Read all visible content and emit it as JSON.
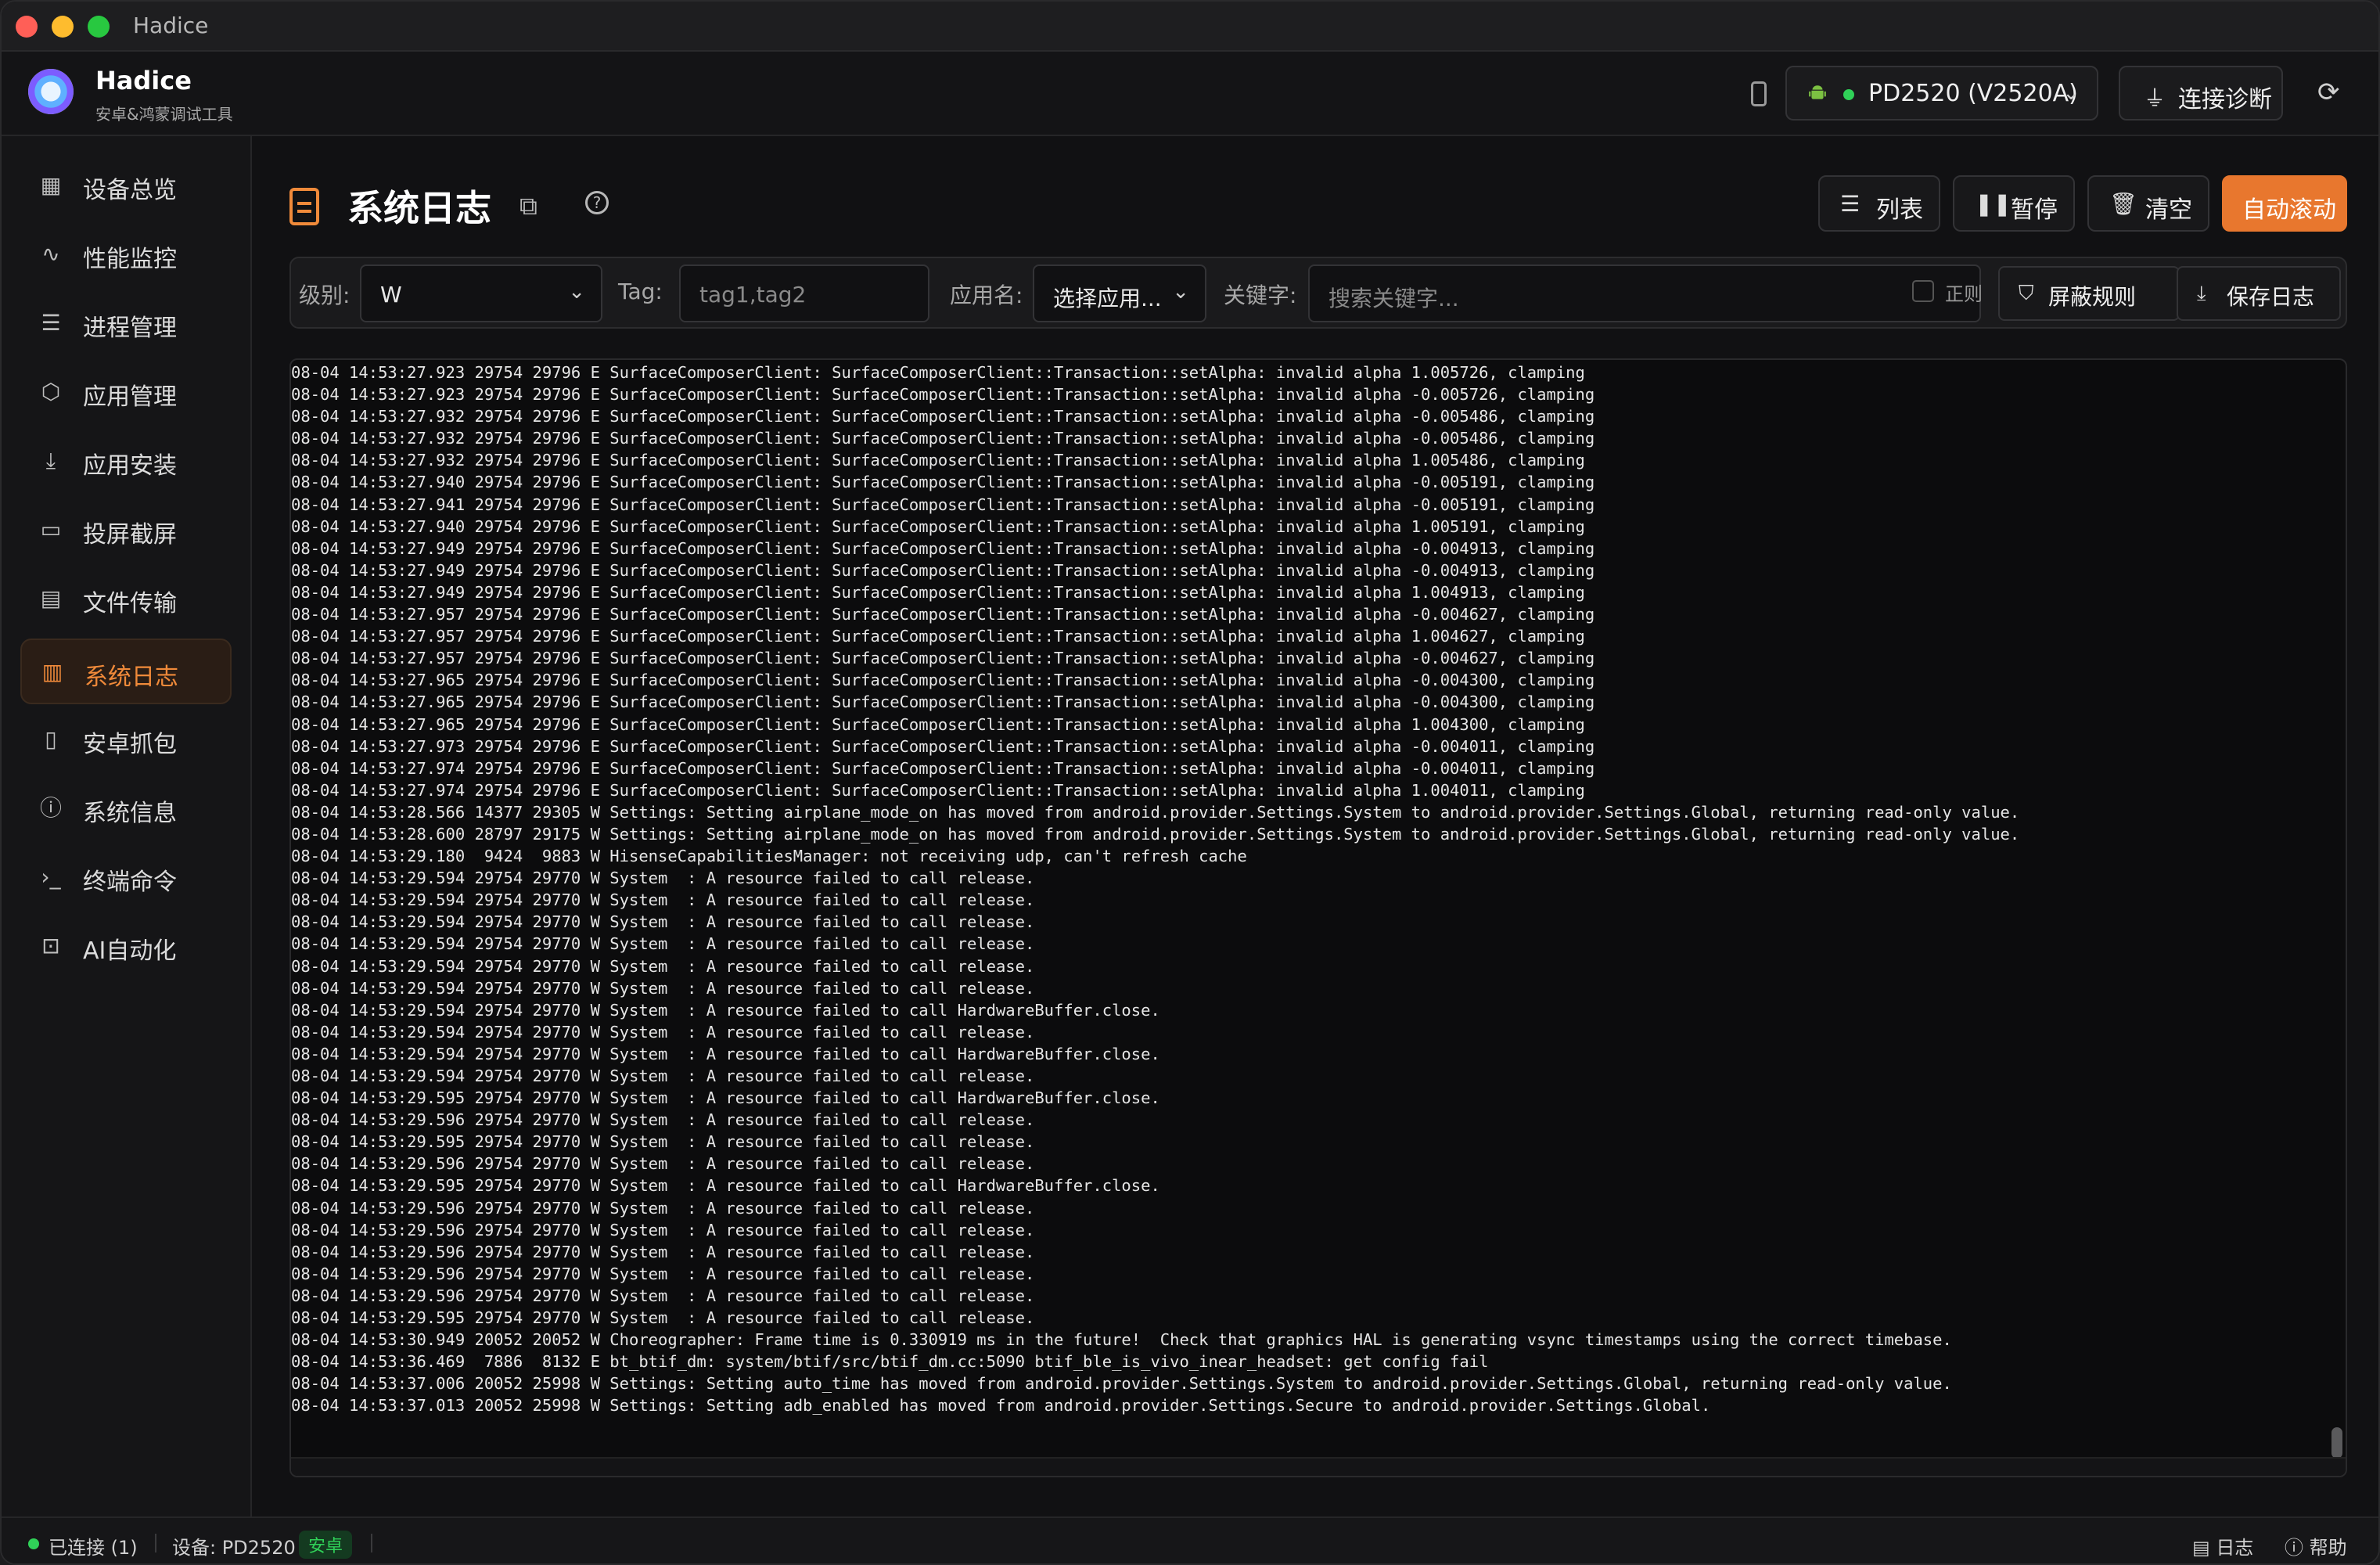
{
  "window": {
    "title": "Hadice"
  },
  "header": {
    "app_name": "Hadice",
    "app_subtitle": "安卓&鸿蒙调试工具",
    "device_label": "PD2520 (V2520A)",
    "diag_label": "连接诊断"
  },
  "sidebar": {
    "items": [
      {
        "label": "设备总览",
        "icon": "grid-icon"
      },
      {
        "label": "性能监控",
        "icon": "activity-icon"
      },
      {
        "label": "进程管理",
        "icon": "list-tree-icon"
      },
      {
        "label": "应用管理",
        "icon": "package-icon"
      },
      {
        "label": "应用安装",
        "icon": "download-icon"
      },
      {
        "label": "投屏截屏",
        "icon": "cast-icon"
      },
      {
        "label": "文件传输",
        "icon": "folder-sync-icon"
      },
      {
        "label": "系统日志",
        "icon": "file-text-icon",
        "active": true
      },
      {
        "label": "安卓抓包",
        "icon": "smartphone-icon"
      },
      {
        "label": "系统信息",
        "icon": "info-icon"
      },
      {
        "label": "终端命令",
        "icon": "terminal-icon"
      },
      {
        "label": "AI自动化",
        "icon": "bot-icon"
      }
    ]
  },
  "page": {
    "title": "系统日志",
    "toolbar": {
      "list": "列表",
      "pause": "暂停",
      "clear": "清空",
      "auto_scroll": "自动滚动"
    }
  },
  "filters": {
    "level_label": "级别:",
    "level_value": "W",
    "tag_label": "Tag:",
    "tag_placeholder": "tag1,tag2",
    "app_label": "应用名:",
    "app_value": "选择应用...",
    "keyword_label": "关键字:",
    "keyword_placeholder": "搜索关键字...",
    "regex_label": "正则",
    "mask_rules": "屏蔽规则",
    "save_log": "保存日志"
  },
  "log_lines": [
    "08-04 14:53:27.923 29754 29796 E SurfaceComposerClient: SurfaceComposerClient::Transaction::setAlpha: invalid alpha 1.005726, clamping",
    "08-04 14:53:27.923 29754 29796 E SurfaceComposerClient: SurfaceComposerClient::Transaction::setAlpha: invalid alpha -0.005726, clamping",
    "08-04 14:53:27.932 29754 29796 E SurfaceComposerClient: SurfaceComposerClient::Transaction::setAlpha: invalid alpha -0.005486, clamping",
    "08-04 14:53:27.932 29754 29796 E SurfaceComposerClient: SurfaceComposerClient::Transaction::setAlpha: invalid alpha -0.005486, clamping",
    "08-04 14:53:27.932 29754 29796 E SurfaceComposerClient: SurfaceComposerClient::Transaction::setAlpha: invalid alpha 1.005486, clamping",
    "08-04 14:53:27.940 29754 29796 E SurfaceComposerClient: SurfaceComposerClient::Transaction::setAlpha: invalid alpha -0.005191, clamping",
    "08-04 14:53:27.941 29754 29796 E SurfaceComposerClient: SurfaceComposerClient::Transaction::setAlpha: invalid alpha -0.005191, clamping",
    "08-04 14:53:27.940 29754 29796 E SurfaceComposerClient: SurfaceComposerClient::Transaction::setAlpha: invalid alpha 1.005191, clamping",
    "08-04 14:53:27.949 29754 29796 E SurfaceComposerClient: SurfaceComposerClient::Transaction::setAlpha: invalid alpha -0.004913, clamping",
    "08-04 14:53:27.949 29754 29796 E SurfaceComposerClient: SurfaceComposerClient::Transaction::setAlpha: invalid alpha -0.004913, clamping",
    "08-04 14:53:27.949 29754 29796 E SurfaceComposerClient: SurfaceComposerClient::Transaction::setAlpha: invalid alpha 1.004913, clamping",
    "08-04 14:53:27.957 29754 29796 E SurfaceComposerClient: SurfaceComposerClient::Transaction::setAlpha: invalid alpha -0.004627, clamping",
    "08-04 14:53:27.957 29754 29796 E SurfaceComposerClient: SurfaceComposerClient::Transaction::setAlpha: invalid alpha 1.004627, clamping",
    "08-04 14:53:27.957 29754 29796 E SurfaceComposerClient: SurfaceComposerClient::Transaction::setAlpha: invalid alpha -0.004627, clamping",
    "08-04 14:53:27.965 29754 29796 E SurfaceComposerClient: SurfaceComposerClient::Transaction::setAlpha: invalid alpha -0.004300, clamping",
    "08-04 14:53:27.965 29754 29796 E SurfaceComposerClient: SurfaceComposerClient::Transaction::setAlpha: invalid alpha -0.004300, clamping",
    "08-04 14:53:27.965 29754 29796 E SurfaceComposerClient: SurfaceComposerClient::Transaction::setAlpha: invalid alpha 1.004300, clamping",
    "08-04 14:53:27.973 29754 29796 E SurfaceComposerClient: SurfaceComposerClient::Transaction::setAlpha: invalid alpha -0.004011, clamping",
    "08-04 14:53:27.974 29754 29796 E SurfaceComposerClient: SurfaceComposerClient::Transaction::setAlpha: invalid alpha -0.004011, clamping",
    "08-04 14:53:27.974 29754 29796 E SurfaceComposerClient: SurfaceComposerClient::Transaction::setAlpha: invalid alpha 1.004011, clamping",
    "08-04 14:53:28.566 14377 29305 W Settings: Setting airplane_mode_on has moved from android.provider.Settings.System to android.provider.Settings.Global, returning read-only value.",
    "08-04 14:53:28.600 28797 29175 W Settings: Setting airplane_mode_on has moved from android.provider.Settings.System to android.provider.Settings.Global, returning read-only value.",
    "08-04 14:53:29.180  9424  9883 W HisenseCapabilitiesManager: not receiving udp, can't refresh cache",
    "08-04 14:53:29.594 29754 29770 W System  : A resource failed to call release.",
    "08-04 14:53:29.594 29754 29770 W System  : A resource failed to call release.",
    "08-04 14:53:29.594 29754 29770 W System  : A resource failed to call release.",
    "08-04 14:53:29.594 29754 29770 W System  : A resource failed to call release.",
    "08-04 14:53:29.594 29754 29770 W System  : A resource failed to call release.",
    "08-04 14:53:29.594 29754 29770 W System  : A resource failed to call release.",
    "08-04 14:53:29.594 29754 29770 W System  : A resource failed to call HardwareBuffer.close.",
    "08-04 14:53:29.594 29754 29770 W System  : A resource failed to call release.",
    "08-04 14:53:29.594 29754 29770 W System  : A resource failed to call HardwareBuffer.close.",
    "08-04 14:53:29.594 29754 29770 W System  : A resource failed to call release.",
    "08-04 14:53:29.595 29754 29770 W System  : A resource failed to call HardwareBuffer.close.",
    "08-04 14:53:29.596 29754 29770 W System  : A resource failed to call release.",
    "08-04 14:53:29.595 29754 29770 W System  : A resource failed to call release.",
    "08-04 14:53:29.596 29754 29770 W System  : A resource failed to call release.",
    "08-04 14:53:29.595 29754 29770 W System  : A resource failed to call HardwareBuffer.close.",
    "08-04 14:53:29.596 29754 29770 W System  : A resource failed to call release.",
    "08-04 14:53:29.596 29754 29770 W System  : A resource failed to call release.",
    "08-04 14:53:29.596 29754 29770 W System  : A resource failed to call release.",
    "08-04 14:53:29.596 29754 29770 W System  : A resource failed to call release.",
    "08-04 14:53:29.596 29754 29770 W System  : A resource failed to call release.",
    "08-04 14:53:29.595 29754 29770 W System  : A resource failed to call release.",
    "08-04 14:53:30.949 20052 20052 W Choreographer: Frame time is 0.330919 ms in the future!  Check that graphics HAL is generating vsync timestamps using the correct timebase.",
    "08-04 14:53:36.469  7886  8132 E bt_btif_dm: system/btif/src/btif_dm.cc:5090 btif_ble_is_vivo_inear_headset: get config fail",
    "08-04 14:53:37.006 20052 25998 W Settings: Setting auto_time has moved from android.provider.Settings.System to android.provider.Settings.Global, returning read-only value.",
    "08-04 14:53:37.013 20052 25998 W Settings: Setting adb_enabled has moved from android.provider.Settings.Secure to android.provider.Settings.Global."
  ],
  "status": {
    "connected": "已连接 (1)",
    "device": "设备: PD2520",
    "platform_badge": "安卓",
    "log_link": "日志",
    "help_link": "帮助"
  },
  "colors": {
    "accent": "#e8772e",
    "online": "#30d158"
  }
}
